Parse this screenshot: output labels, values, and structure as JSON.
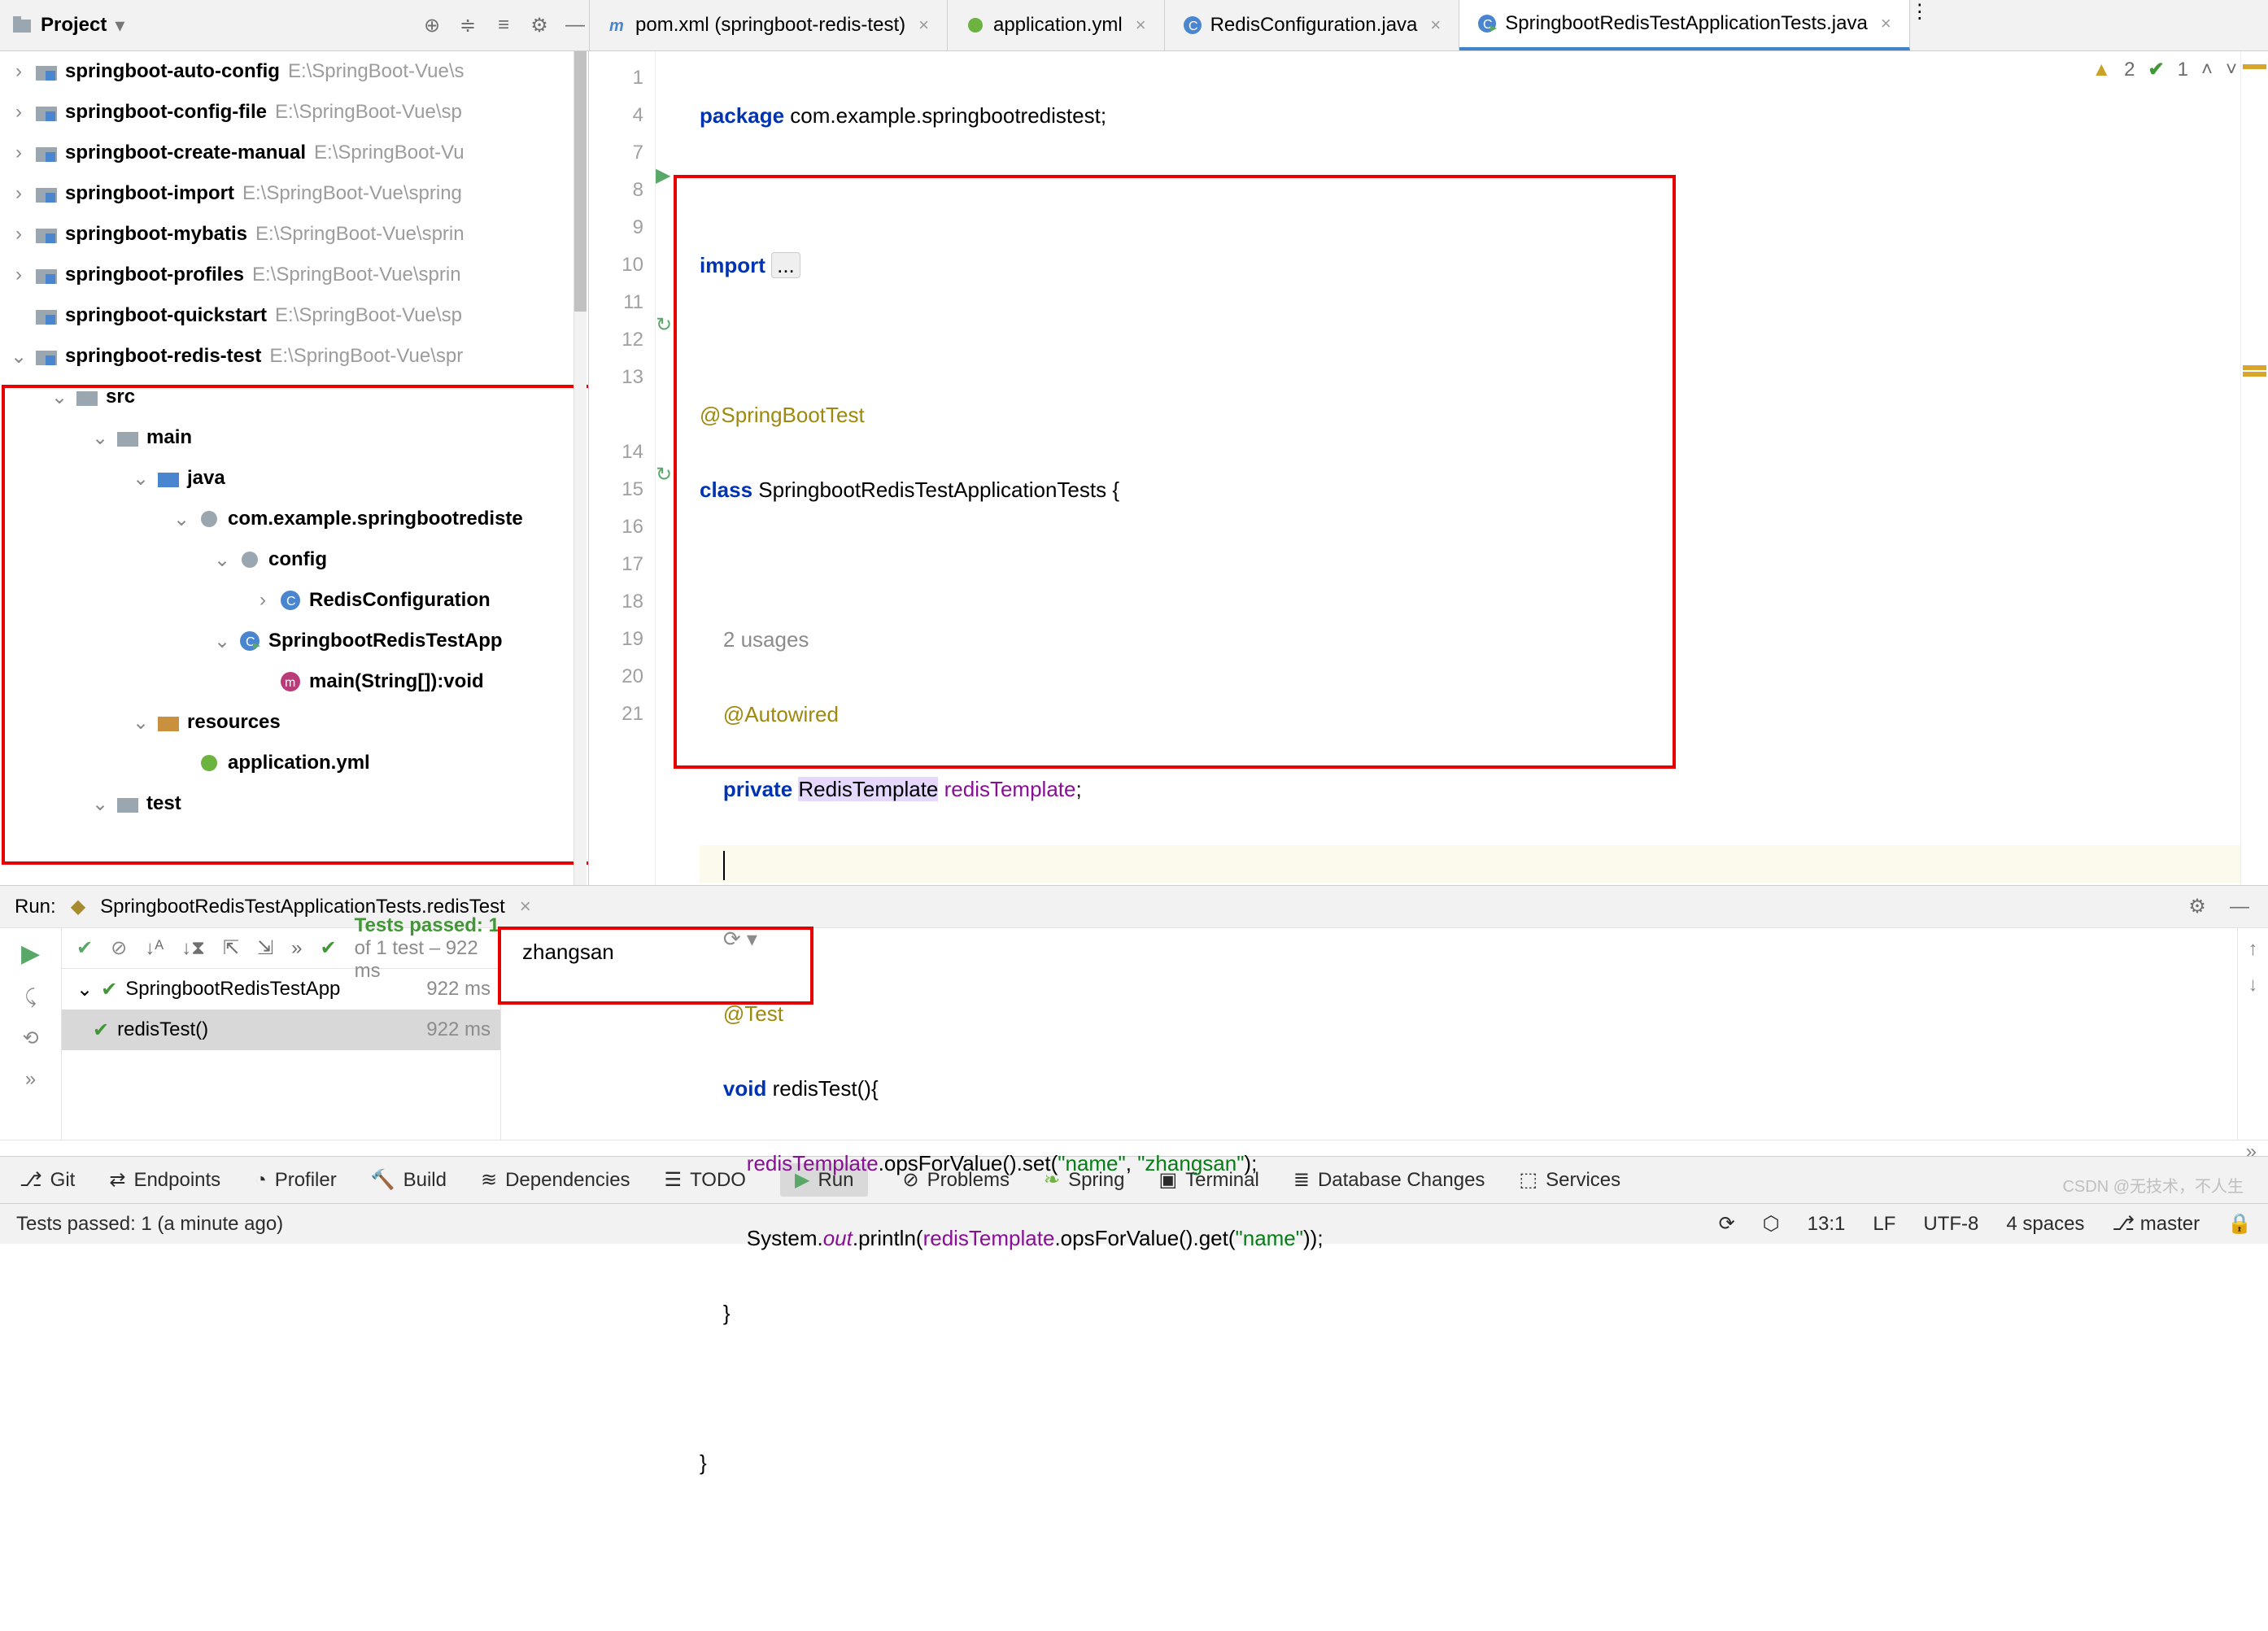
{
  "project_label": "Project",
  "tabs": [
    {
      "icon": "m",
      "label": "pom.xml (springboot-redis-test)",
      "active": false
    },
    {
      "icon": "yml",
      "label": "application.yml",
      "active": false
    },
    {
      "icon": "c",
      "label": "RedisConfiguration.java",
      "active": false
    },
    {
      "icon": "c",
      "label": "SpringbootRedisTestApplicationTests.java",
      "active": true
    }
  ],
  "tree": [
    {
      "indent": 0,
      "arrow": "right",
      "icon": "mod",
      "name": "springboot-auto-config",
      "path": "E:\\SpringBoot-Vue\\s"
    },
    {
      "indent": 0,
      "arrow": "right",
      "icon": "mod",
      "name": "springboot-config-file",
      "path": "E:\\SpringBoot-Vue\\sp"
    },
    {
      "indent": 0,
      "arrow": "right",
      "icon": "mod",
      "name": "springboot-create-manual",
      "path": "E:\\SpringBoot-Vu"
    },
    {
      "indent": 0,
      "arrow": "right",
      "icon": "mod",
      "name": "springboot-import",
      "path": "E:\\SpringBoot-Vue\\spring"
    },
    {
      "indent": 0,
      "arrow": "right",
      "icon": "mod",
      "name": "springboot-mybatis",
      "path": "E:\\SpringBoot-Vue\\sprin"
    },
    {
      "indent": 0,
      "arrow": "right",
      "icon": "mod",
      "name": "springboot-profiles",
      "path": "E:\\SpringBoot-Vue\\sprin"
    },
    {
      "indent": 0,
      "arrow": "none",
      "icon": "mod",
      "name": "springboot-quickstart",
      "path": "E:\\SpringBoot-Vue\\sp"
    },
    {
      "indent": 0,
      "arrow": "down",
      "icon": "mod",
      "name": "springboot-redis-test",
      "path": "E:\\SpringBoot-Vue\\spr"
    },
    {
      "indent": 1,
      "arrow": "down",
      "icon": "fld",
      "name": "src",
      "path": ""
    },
    {
      "indent": 2,
      "arrow": "down",
      "icon": "fld",
      "name": "main",
      "path": ""
    },
    {
      "indent": 3,
      "arrow": "down",
      "icon": "src",
      "name": "java",
      "path": ""
    },
    {
      "indent": 4,
      "arrow": "down",
      "icon": "pkg",
      "name": "com.example.springbootrediste",
      "path": ""
    },
    {
      "indent": 5,
      "arrow": "down",
      "icon": "pkg",
      "name": "config",
      "path": ""
    },
    {
      "indent": 6,
      "arrow": "right",
      "icon": "cls",
      "name": "RedisConfiguration",
      "path": ""
    },
    {
      "indent": 5,
      "arrow": "down",
      "icon": "clsr",
      "name": "SpringbootRedisTestApp",
      "path": ""
    },
    {
      "indent": 6,
      "arrow": "none",
      "icon": "mth",
      "name": "main(String[]):void",
      "path": ""
    },
    {
      "indent": 3,
      "arrow": "down",
      "icon": "res",
      "name": "resources",
      "path": ""
    },
    {
      "indent": 4,
      "arrow": "none",
      "icon": "yml",
      "name": "application.yml",
      "path": ""
    },
    {
      "indent": 2,
      "arrow": "down",
      "icon": "fld",
      "name": "test",
      "path": ""
    }
  ],
  "editor": {
    "lines": [
      "1",
      "4",
      "7",
      "8",
      "9",
      "10",
      "11",
      "12",
      "13",
      "14",
      "15",
      "16",
      "17",
      "18",
      "19",
      "20",
      "21"
    ],
    "pkg_kw": "package",
    "pkg_val": " com.example.springbootredistest;",
    "imp_kw": "import ",
    "imp_dots": "...",
    "ann_sbt": "@SpringBootTest",
    "cls_kw": "class ",
    "cls_nm": "SpringbootRedisTestApplicationTests",
    " brace_o": " {",
    "usages": "2 usages",
    "ann_aw": "@Autowired",
    "priv": "private ",
    "type": "RedisTemplate",
    "fld": " redisTemplate",
    ";": ";",
    "ann_test": "@Test",
    "void": "void ",
    "mname": "redisTest",
    "sig": "(){",
    "l1a": "redisTemplate",
    "l1b": ".opsForValue().set(",
    "l1s1": "\"name\"",
    "l1c": ", ",
    "l1s2": "\"zhangsan\"",
    "l1d": ");",
    "l2a": "System.",
    "l2out": "out",
    "l2b": ".println(",
    "l2c": "redisTemplate",
    "l2d": ".opsForValue().get(",
    "l2s": "\"name\"",
    "l2e": "));",
    "brace_c1": "}",
    "brace_c2": "}",
    "caret": "|"
  },
  "inspections": {
    "warn_n": "2",
    "ok_n": "1"
  },
  "run": {
    "label": "Run:",
    "config": "SpringbootRedisTestApplicationTests.redisTest",
    "summary_pre": "Tests passed: ",
    "summary_n": "1",
    "summary_post": " of 1 test – 922 ms",
    "tree": [
      {
        "name": "SpringbootRedisTestApp",
        "time": "922 ms",
        "sel": false,
        "arrow": true
      },
      {
        "name": "redisTest()",
        "time": "922 ms",
        "sel": true,
        "arrow": false
      }
    ],
    "output": "zhangsan"
  },
  "bottom_tools": [
    "Git",
    "Endpoints",
    "Profiler",
    "Build",
    "Dependencies",
    "TODO",
    "Run",
    "Problems",
    "Spring",
    "Terminal",
    "Database Changes",
    "Services"
  ],
  "bottom_active": "Run",
  "status": {
    "left": "Tests passed: 1 (a minute ago)",
    "pos": "13:1",
    "le": "LF",
    "enc": "UTF-8",
    "indent": "4 spaces",
    "branch": "master",
    "lock": "🔒"
  },
  "watermark": "CSDN @无技术，不人生"
}
